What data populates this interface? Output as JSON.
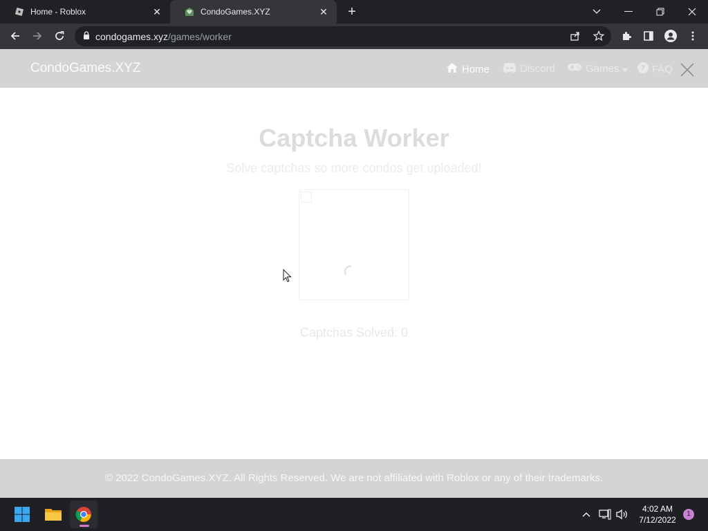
{
  "browser": {
    "tabs": [
      {
        "title": "Home - Roblox",
        "close": "✕"
      },
      {
        "title": "CondoGames.XYZ",
        "close": "✕"
      }
    ],
    "newtab": "+",
    "address": {
      "host": "condogames.xyz",
      "path": "/games/worker"
    }
  },
  "site": {
    "brand": "CondoGames.XYZ",
    "nav": [
      {
        "label": "Home",
        "icon": "home-icon"
      },
      {
        "label": "Discord",
        "icon": "discord-icon"
      },
      {
        "label": "Games",
        "icon": "gamepad-icon"
      },
      {
        "label": "FAQ",
        "icon": "question-icon"
      }
    ],
    "title": "Captcha Worker",
    "subtitle": "Solve captchas so more condos get uploaded!",
    "solved_label": "Captchas Solved: 0",
    "footer": "© 2022 CondoGames.XYZ. All Rights Reserved. We are not affiliated with Roblox or any of their trademarks."
  },
  "taskbar": {
    "time": "4:02 AM",
    "date": "7/12/2022",
    "notifications": "1"
  }
}
